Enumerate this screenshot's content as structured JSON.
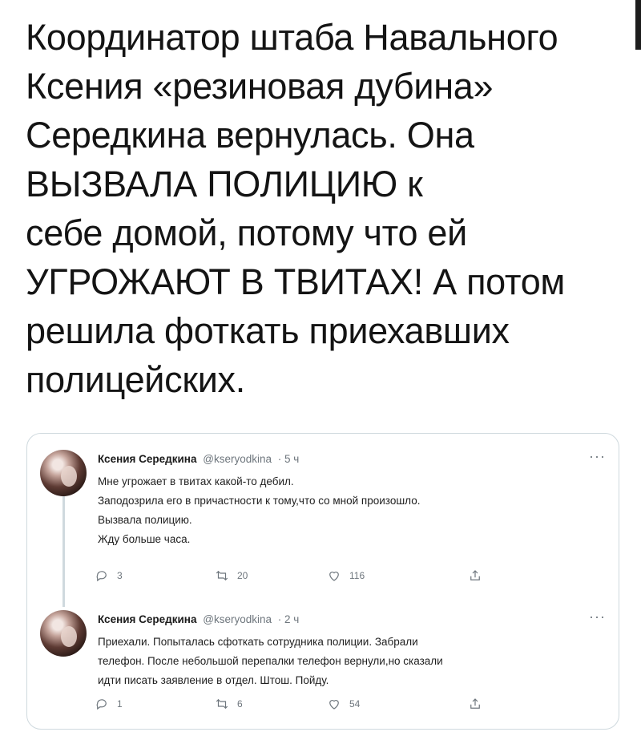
{
  "headline": {
    "lines": [
      "Координатор штаба Навального",
      "Ксения «резиновая дубина»",
      "Середкина вернулась. Она",
      "ВЫЗВАЛА ПОЛИЦИЮ к",
      "себе домой, потому что ей",
      "УГРОЖАЮТ В ТВИТАХ! А потом",
      "решила фоткать приехавших",
      "полицейских."
    ]
  },
  "tweets": [
    {
      "name": "Ксения Середкина",
      "handle": "@kseryodkina",
      "time": "· 5 ч",
      "more": "···",
      "lines": [
        "Мне угрожает в твитах какой-то дебил.",
        "Заподозрила его в причастности к тому,что со мной произошло.",
        "Вызвала полицию.",
        "Жду больше часа."
      ],
      "replies": "3",
      "retweets": "20",
      "likes": "116"
    },
    {
      "name": "Ксения Середкина",
      "handle": "@kseryodkina",
      "time": "· 2 ч",
      "more": "···",
      "lines": [
        "Приехали. Попыталась сфоткать сотрудника полиции. Забрали",
        "телефон. После небольшой перепалки телефон вернули,но сказали",
        "идти писать заявление в отдел. Штош. Пойду."
      ],
      "replies": "1",
      "retweets": "6",
      "likes": "54"
    }
  ],
  "icons": {
    "reply": "reply-icon",
    "retweet": "retweet-icon",
    "like": "heart-icon",
    "share": "share-icon"
  },
  "colors": {
    "text": "#141414",
    "secondary": "#6e767d",
    "border": "#cfd9de"
  }
}
